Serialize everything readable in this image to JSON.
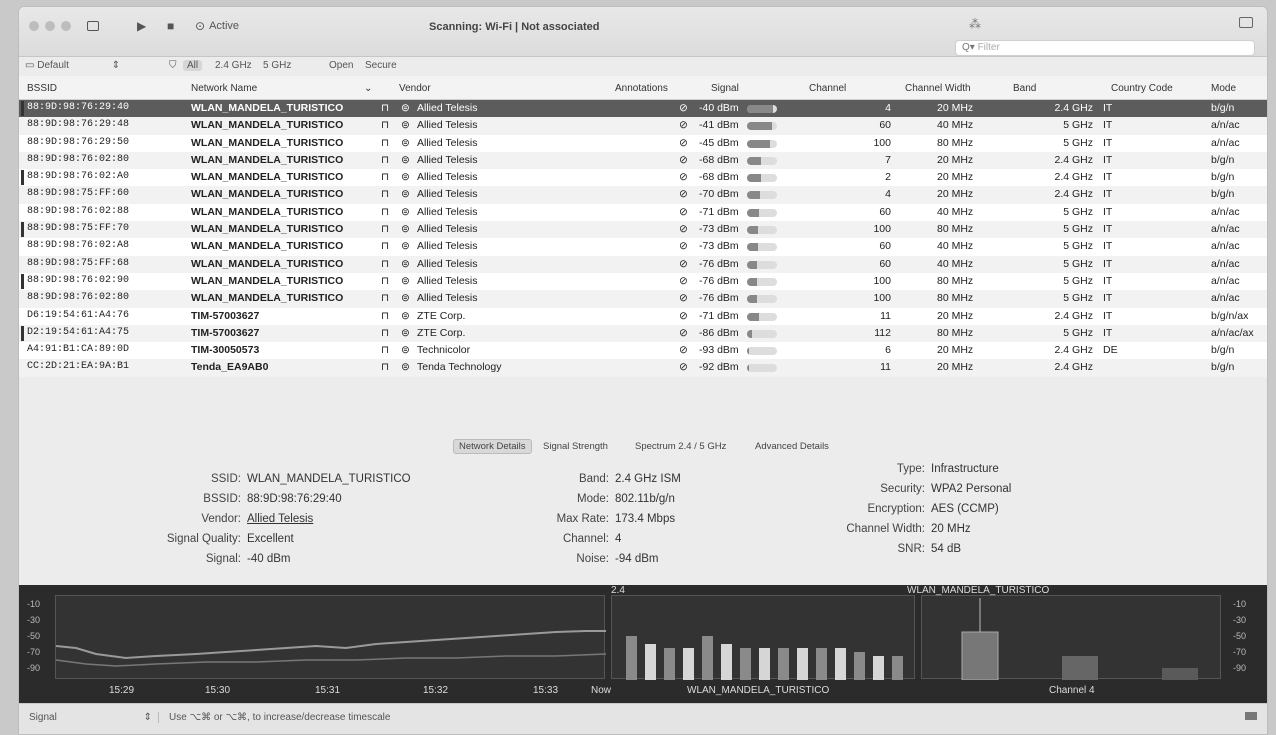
{
  "titlebar": {
    "active_label": "Active",
    "scanning_text": "Scanning: Wi-Fi | Not associated",
    "filter_placeholder": "Filter"
  },
  "filterbar": {
    "profile": "Default",
    "all": "All",
    "band_24": "2.4 GHz",
    "band_5": "5 GHz",
    "open": "Open",
    "secure": "Secure"
  },
  "columns": {
    "bssid": "BSSID",
    "network_name": "Network Name",
    "vendor": "Vendor",
    "annotations": "Annotations",
    "signal": "Signal",
    "channel": "Channel",
    "channel_width": "Channel Width",
    "band": "Band",
    "country_code": "Country Code",
    "mode": "Mode"
  },
  "rows": [
    {
      "bssid": "88:9D:98:76:29:40",
      "name": "WLAN_MANDELA_TURISTICO",
      "vendor": "Allied Telesis",
      "signal": "-40 dBm",
      "level": 0.85,
      "channel": "4",
      "width": "20 MHz",
      "band": "2.4 GHz",
      "cc": "IT",
      "mode": "b/g/n"
    },
    {
      "bssid": "88:9D:98:76:29:48",
      "name": "WLAN_MANDELA_TURISTICO",
      "vendor": "Allied Telesis",
      "signal": "-41 dBm",
      "level": 0.83,
      "channel": "60",
      "width": "40 MHz",
      "band": "5 GHz",
      "cc": "IT",
      "mode": "a/n/ac"
    },
    {
      "bssid": "88:9D:98:76:29:50",
      "name": "WLAN_MANDELA_TURISTICO",
      "vendor": "Allied Telesis",
      "signal": "-45 dBm",
      "level": 0.78,
      "channel": "100",
      "width": "80 MHz",
      "band": "5 GHz",
      "cc": "IT",
      "mode": "a/n/ac"
    },
    {
      "bssid": "88:9D:98:76:02:80",
      "name": "WLAN_MANDELA_TURISTICO",
      "vendor": "Allied Telesis",
      "signal": "-68 dBm",
      "level": 0.45,
      "channel": "7",
      "width": "20 MHz",
      "band": "2.4 GHz",
      "cc": "IT",
      "mode": "b/g/n"
    },
    {
      "bssid": "88:9D:98:76:02:A0",
      "name": "WLAN_MANDELA_TURISTICO",
      "vendor": "Allied Telesis",
      "signal": "-68 dBm",
      "level": 0.45,
      "channel": "2",
      "width": "20 MHz",
      "band": "2.4 GHz",
      "cc": "IT",
      "mode": "b/g/n"
    },
    {
      "bssid": "88:9D:98:75:FF:60",
      "name": "WLAN_MANDELA_TURISTICO",
      "vendor": "Allied Telesis",
      "signal": "-70 dBm",
      "level": 0.42,
      "channel": "4",
      "width": "20 MHz",
      "band": "2.4 GHz",
      "cc": "IT",
      "mode": "b/g/n"
    },
    {
      "bssid": "88:9D:98:76:02:88",
      "name": "WLAN_MANDELA_TURISTICO",
      "vendor": "Allied Telesis",
      "signal": "-71 dBm",
      "level": 0.4,
      "channel": "60",
      "width": "40 MHz",
      "band": "5 GHz",
      "cc": "IT",
      "mode": "a/n/ac"
    },
    {
      "bssid": "88:9D:98:75:FF:70",
      "name": "WLAN_MANDELA_TURISTICO",
      "vendor": "Allied Telesis",
      "signal": "-73 dBm",
      "level": 0.38,
      "channel": "100",
      "width": "80 MHz",
      "band": "5 GHz",
      "cc": "IT",
      "mode": "a/n/ac"
    },
    {
      "bssid": "88:9D:98:76:02:A8",
      "name": "WLAN_MANDELA_TURISTICO",
      "vendor": "Allied Telesis",
      "signal": "-73 dBm",
      "level": 0.38,
      "channel": "60",
      "width": "40 MHz",
      "band": "5 GHz",
      "cc": "IT",
      "mode": "a/n/ac"
    },
    {
      "bssid": "88:9D:98:75:FF:68",
      "name": "WLAN_MANDELA_TURISTICO",
      "vendor": "Allied Telesis",
      "signal": "-76 dBm",
      "level": 0.34,
      "channel": "60",
      "width": "40 MHz",
      "band": "5 GHz",
      "cc": "IT",
      "mode": "a/n/ac"
    },
    {
      "bssid": "88:9D:98:76:02:90",
      "name": "WLAN_MANDELA_TURISTICO",
      "vendor": "Allied Telesis",
      "signal": "-76 dBm",
      "level": 0.34,
      "channel": "100",
      "width": "80 MHz",
      "band": "5 GHz",
      "cc": "IT",
      "mode": "a/n/ac"
    },
    {
      "bssid": "88:9D:98:76:02:80",
      "name": "WLAN_MANDELA_TURISTICO",
      "vendor": "Allied Telesis",
      "signal": "-76 dBm",
      "level": 0.34,
      "channel": "100",
      "width": "80 MHz",
      "band": "5 GHz",
      "cc": "IT",
      "mode": "a/n/ac"
    },
    {
      "bssid": "D6:19:54:61:A4:76",
      "name": "TIM-57003627",
      "vendor": "ZTE Corp.",
      "signal": "-71 dBm",
      "level": 0.4,
      "channel": "11",
      "width": "20 MHz",
      "band": "2.4 GHz",
      "cc": "IT",
      "mode": "b/g/n/ax"
    },
    {
      "bssid": "D2:19:54:61:A4:75",
      "name": "TIM-57003627",
      "vendor": "ZTE Corp.",
      "signal": "-86 dBm",
      "level": 0.18,
      "channel": "112",
      "width": "80 MHz",
      "band": "5 GHz",
      "cc": "IT",
      "mode": "a/n/ac/ax"
    },
    {
      "bssid": "A4:91:B1:CA:89:0D",
      "name": "TIM-30050573",
      "vendor": "Technicolor",
      "signal": "-93 dBm",
      "level": 0.05,
      "channel": "6",
      "width": "20 MHz",
      "band": "2.4 GHz",
      "cc": "DE",
      "mode": "b/g/n"
    },
    {
      "bssid": "CC:2D:21:EA:9A:B1",
      "name": "Tenda_EA9AB0",
      "vendor": "Tenda Technology",
      "signal": "-92 dBm",
      "level": 0.06,
      "channel": "11",
      "width": "20 MHz",
      "band": "2.4 GHz",
      "cc": "",
      "mode": "b/g/n"
    }
  ],
  "tabs": [
    "Network Details",
    "Signal Strength",
    "Spectrum 2.4 / 5 GHz",
    "Advanced Details"
  ],
  "details": {
    "ssid_label": "SSID:",
    "ssid": "WLAN_MANDELA_TURISTICO",
    "bssid_label": "BSSID:",
    "bssid": "88:9D:98:76:29:40",
    "vendor_label": "Vendor:",
    "vendor": "Allied Telesis",
    "quality_label": "Signal Quality:",
    "quality": "Excellent",
    "signal_label": "Signal:",
    "signal": "-40 dBm",
    "band_label": "Band:",
    "band": "2.4 GHz ISM",
    "mode_label": "Mode:",
    "mode": "802.11b/g/n",
    "maxrate_label": "Max Rate:",
    "maxrate": "173.4 Mbps",
    "channel_label": "Channel:",
    "channel": "4",
    "noise_label": "Noise:",
    "noise": "-94 dBm",
    "type_label": "Type:",
    "type": "Infrastructure",
    "security_label": "Security:",
    "security": "WPA2 Personal",
    "encryption_label": "Encryption:",
    "encryption": "AES (CCMP)",
    "width_label": "Channel Width:",
    "width": "20 MHz",
    "snr_label": "SNR:",
    "snr": "54 dB"
  },
  "graph": {
    "y_ticks": [
      "-10",
      "-30",
      "-50",
      "-70",
      "-90"
    ],
    "time_ticks": [
      "15:29",
      "15:30",
      "15:31",
      "15:32",
      "15:33",
      "Now"
    ],
    "spectrum_label": "2.4",
    "spectrum_network": "WLAN_MANDELA_TURISTICO",
    "channel_network": "WLAN_MANDELA_TURISTICO",
    "channel_label": "Channel 4",
    "bar_levels": [
      0.55,
      0.45,
      0.4,
      0.4,
      0.55,
      0.45,
      0.4,
      0.4,
      0.4,
      0.4,
      0.4,
      0.4,
      0.35,
      0.3,
      0.3
    ]
  },
  "statusbar": {
    "selector": "Signal",
    "hint": "Use ⌥⌘ or ⌥⌘, to increase/decrease timescale"
  },
  "colors": {
    "selected_row": "#5c5c5c",
    "graph_bg": "#2b2b2b"
  }
}
